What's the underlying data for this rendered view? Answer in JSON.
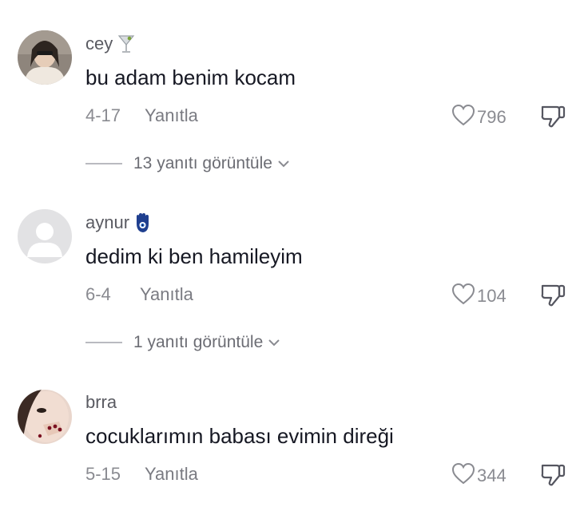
{
  "comments": [
    {
      "username": "cey",
      "badge_icon": "martini-glass-icon",
      "text": "bu adam benim kocam",
      "date": "4-17",
      "reply_label": "Yanıtla",
      "likes": "796",
      "view_replies": "13 yanıtı görüntüle"
    },
    {
      "username": "aynur",
      "badge_icon": "hamsa-hand-icon",
      "text": "dedim ki ben hamileyim",
      "date": "6-4",
      "reply_label": "Yanıtla",
      "likes": "104",
      "view_replies": "1 yanıtı görüntüle"
    },
    {
      "username": "brra",
      "text": "cocuklarımın babası evimin direği",
      "date": "5-15",
      "reply_label": "Yanıtla",
      "likes": "344"
    }
  ],
  "colors": {
    "text": "#161823",
    "muted": "#8a8b91",
    "hamsa": "#1f3f8f"
  }
}
